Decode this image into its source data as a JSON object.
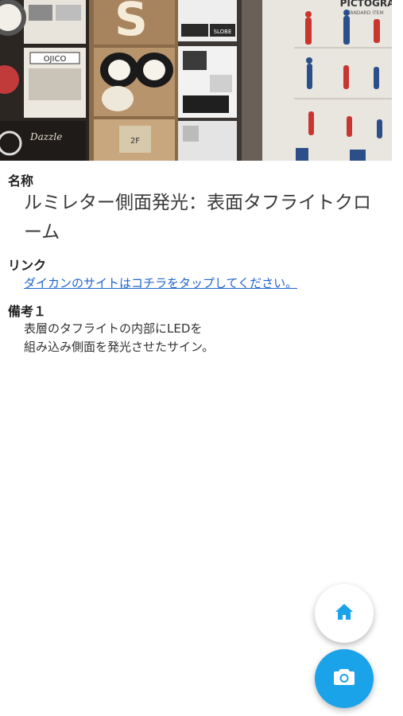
{
  "detail": {
    "name_label": "名称",
    "name_value": "ルミレター側面発光：表面タフライトクローム",
    "link_label": "リンク",
    "link_text": "ダイカンのサイトはコチラをタップしてください。",
    "note_label": "備考１",
    "note_line1": "表層のタフライトの内部にLEDを",
    "note_line2": "組み込み側面を発光させたサイン。"
  },
  "photo": {
    "sign_texts": [
      "OJICO",
      "PICTOGRA",
      "STANDARD ITEM",
      "Dazzle",
      "2F",
      "SLOBE"
    ]
  },
  "fabs": {
    "home_icon": "home-icon",
    "camera_icon": "camera-icon"
  },
  "colors": {
    "link": "#2266cc",
    "camera_fab": "#1aa3e8",
    "home_icon": "#1aa3e8"
  }
}
